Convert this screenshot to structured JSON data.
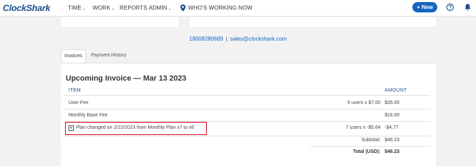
{
  "app": {
    "logo_text": "ClockShark"
  },
  "nav": {
    "time": "TIME",
    "work": "WORK",
    "reports": "REPORTS",
    "admin": "ADMIN",
    "whos_working": "WHO'S WORKING NOW",
    "new_button": "+ New"
  },
  "contact": {
    "phone": "18008280689",
    "separator": "|",
    "email": "sales@clockshark.com"
  },
  "tabs": [
    {
      "label": "Invoices"
    },
    {
      "label": "Payment History"
    }
  ],
  "invoice": {
    "title": "Upcoming Invoice — Mar 13 2023",
    "headers": {
      "item": "ITEM",
      "amount": "AMOUNT"
    },
    "rows": [
      {
        "item": "User Fee",
        "qty": "5 users x $7.00",
        "amount": "$35.00"
      },
      {
        "item": "Monthly Base Fee",
        "qty": "",
        "amount": "$16.00"
      },
      {
        "item": "Plan changed on 2/22/2023 from Monthly Plan x7 to x6",
        "qty": "7 users x -$5.64",
        "amount": "-$4.77"
      }
    ],
    "subtotal_label": "Subtotal:",
    "subtotal": "$46.23",
    "total_label": "Total (USD):",
    "total": "$46.23"
  },
  "colors": {
    "brand": "#1d4f91",
    "accent": "#1565c0",
    "highlight": "#d0021b"
  },
  "icons": [
    "map-pin-icon",
    "help-icon",
    "bell-icon",
    "expand-plus-icon",
    "chevron-down-icon"
  ]
}
